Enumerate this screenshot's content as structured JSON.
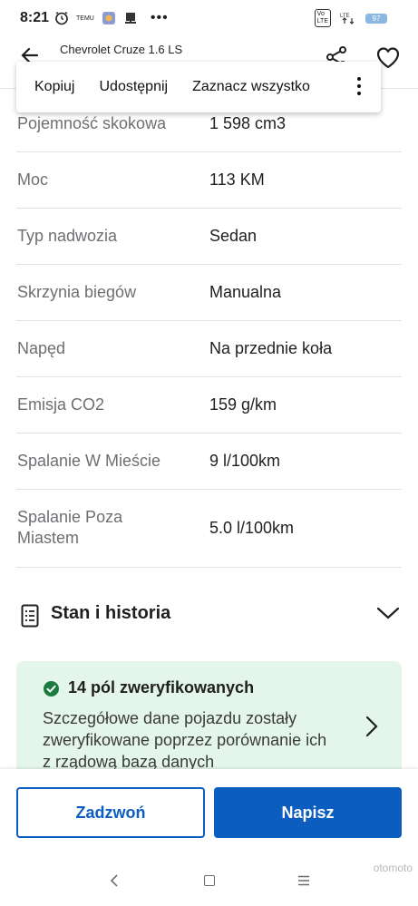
{
  "status_bar": {
    "time": "8:21",
    "app_icons": [
      "clock-icon",
      "temu-icon",
      "rtbf-icon",
      "flag-icon"
    ],
    "temu_label": "TEMU",
    "more_dots": "•••",
    "lte_label": "LTE",
    "battery_level": "97"
  },
  "header": {
    "title": "Chevrolet Cruze 1.6 LS"
  },
  "context_menu": {
    "items": [
      "Kopiuj",
      "Udostępnij",
      "Zaznacz wszystko"
    ]
  },
  "specs": [
    {
      "label": "Pojemność skokowa",
      "value": "1 598 cm3"
    },
    {
      "label": "Moc",
      "value": "113 KM"
    },
    {
      "label": "Typ nadwozia",
      "value": "Sedan"
    },
    {
      "label": "Skrzynia biegów",
      "value": "Manualna"
    },
    {
      "label": "Napęd",
      "value": "Na przednie koła"
    },
    {
      "label": "Emisja CO2",
      "value": "159 g/km"
    },
    {
      "label": "Spalanie W Mieście",
      "value": "9 l/100km"
    },
    {
      "label": "Spalanie Poza Miastem",
      "value": "5.0 l/100km"
    }
  ],
  "section": {
    "title": "Stan i historia"
  },
  "verified_card": {
    "title": "14 pól zweryfikowanych",
    "description": "Szczegółowe dane pojazdu zostały zweryfikowane poprzez porównanie ich z rządową bazą danych"
  },
  "actions": {
    "call_label": "Zadzwoń",
    "write_label": "Napisz"
  },
  "colors": {
    "primary": "#0b5dc0",
    "verified_bg": "#e4f6ec",
    "check_green": "#1b7a3e"
  },
  "watermark": "otomoto"
}
